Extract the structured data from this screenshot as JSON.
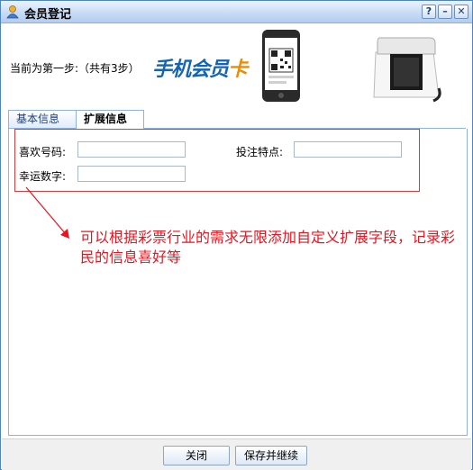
{
  "window": {
    "title": "会员登记"
  },
  "titlebar_buttons": {
    "help": "?",
    "minimize": "–",
    "close": "✕"
  },
  "banner": {
    "step_text": "当前为第一步:（共有3步）",
    "logo_main": "手机会员",
    "logo_accent": "卡"
  },
  "tabs": [
    {
      "label": "基本信息",
      "active": false
    },
    {
      "label": "扩展信息",
      "active": true
    }
  ],
  "form": {
    "fields": [
      {
        "label": "喜欢号码:",
        "value": ""
      },
      {
        "label": "投注特点:",
        "value": ""
      },
      {
        "label": "幸运数字:",
        "value": ""
      }
    ]
  },
  "annotation": "可以根据彩票行业的需求无限添加自定义扩展字段，记录彩民的信息喜好等",
  "footer": {
    "close_label": "关闭",
    "save_label": "保存并继续"
  },
  "colors": {
    "annotation": "#e8141e",
    "logo_blue": "#1464b4",
    "logo_orange": "#f08a00",
    "border_blue": "#4d84c4"
  }
}
